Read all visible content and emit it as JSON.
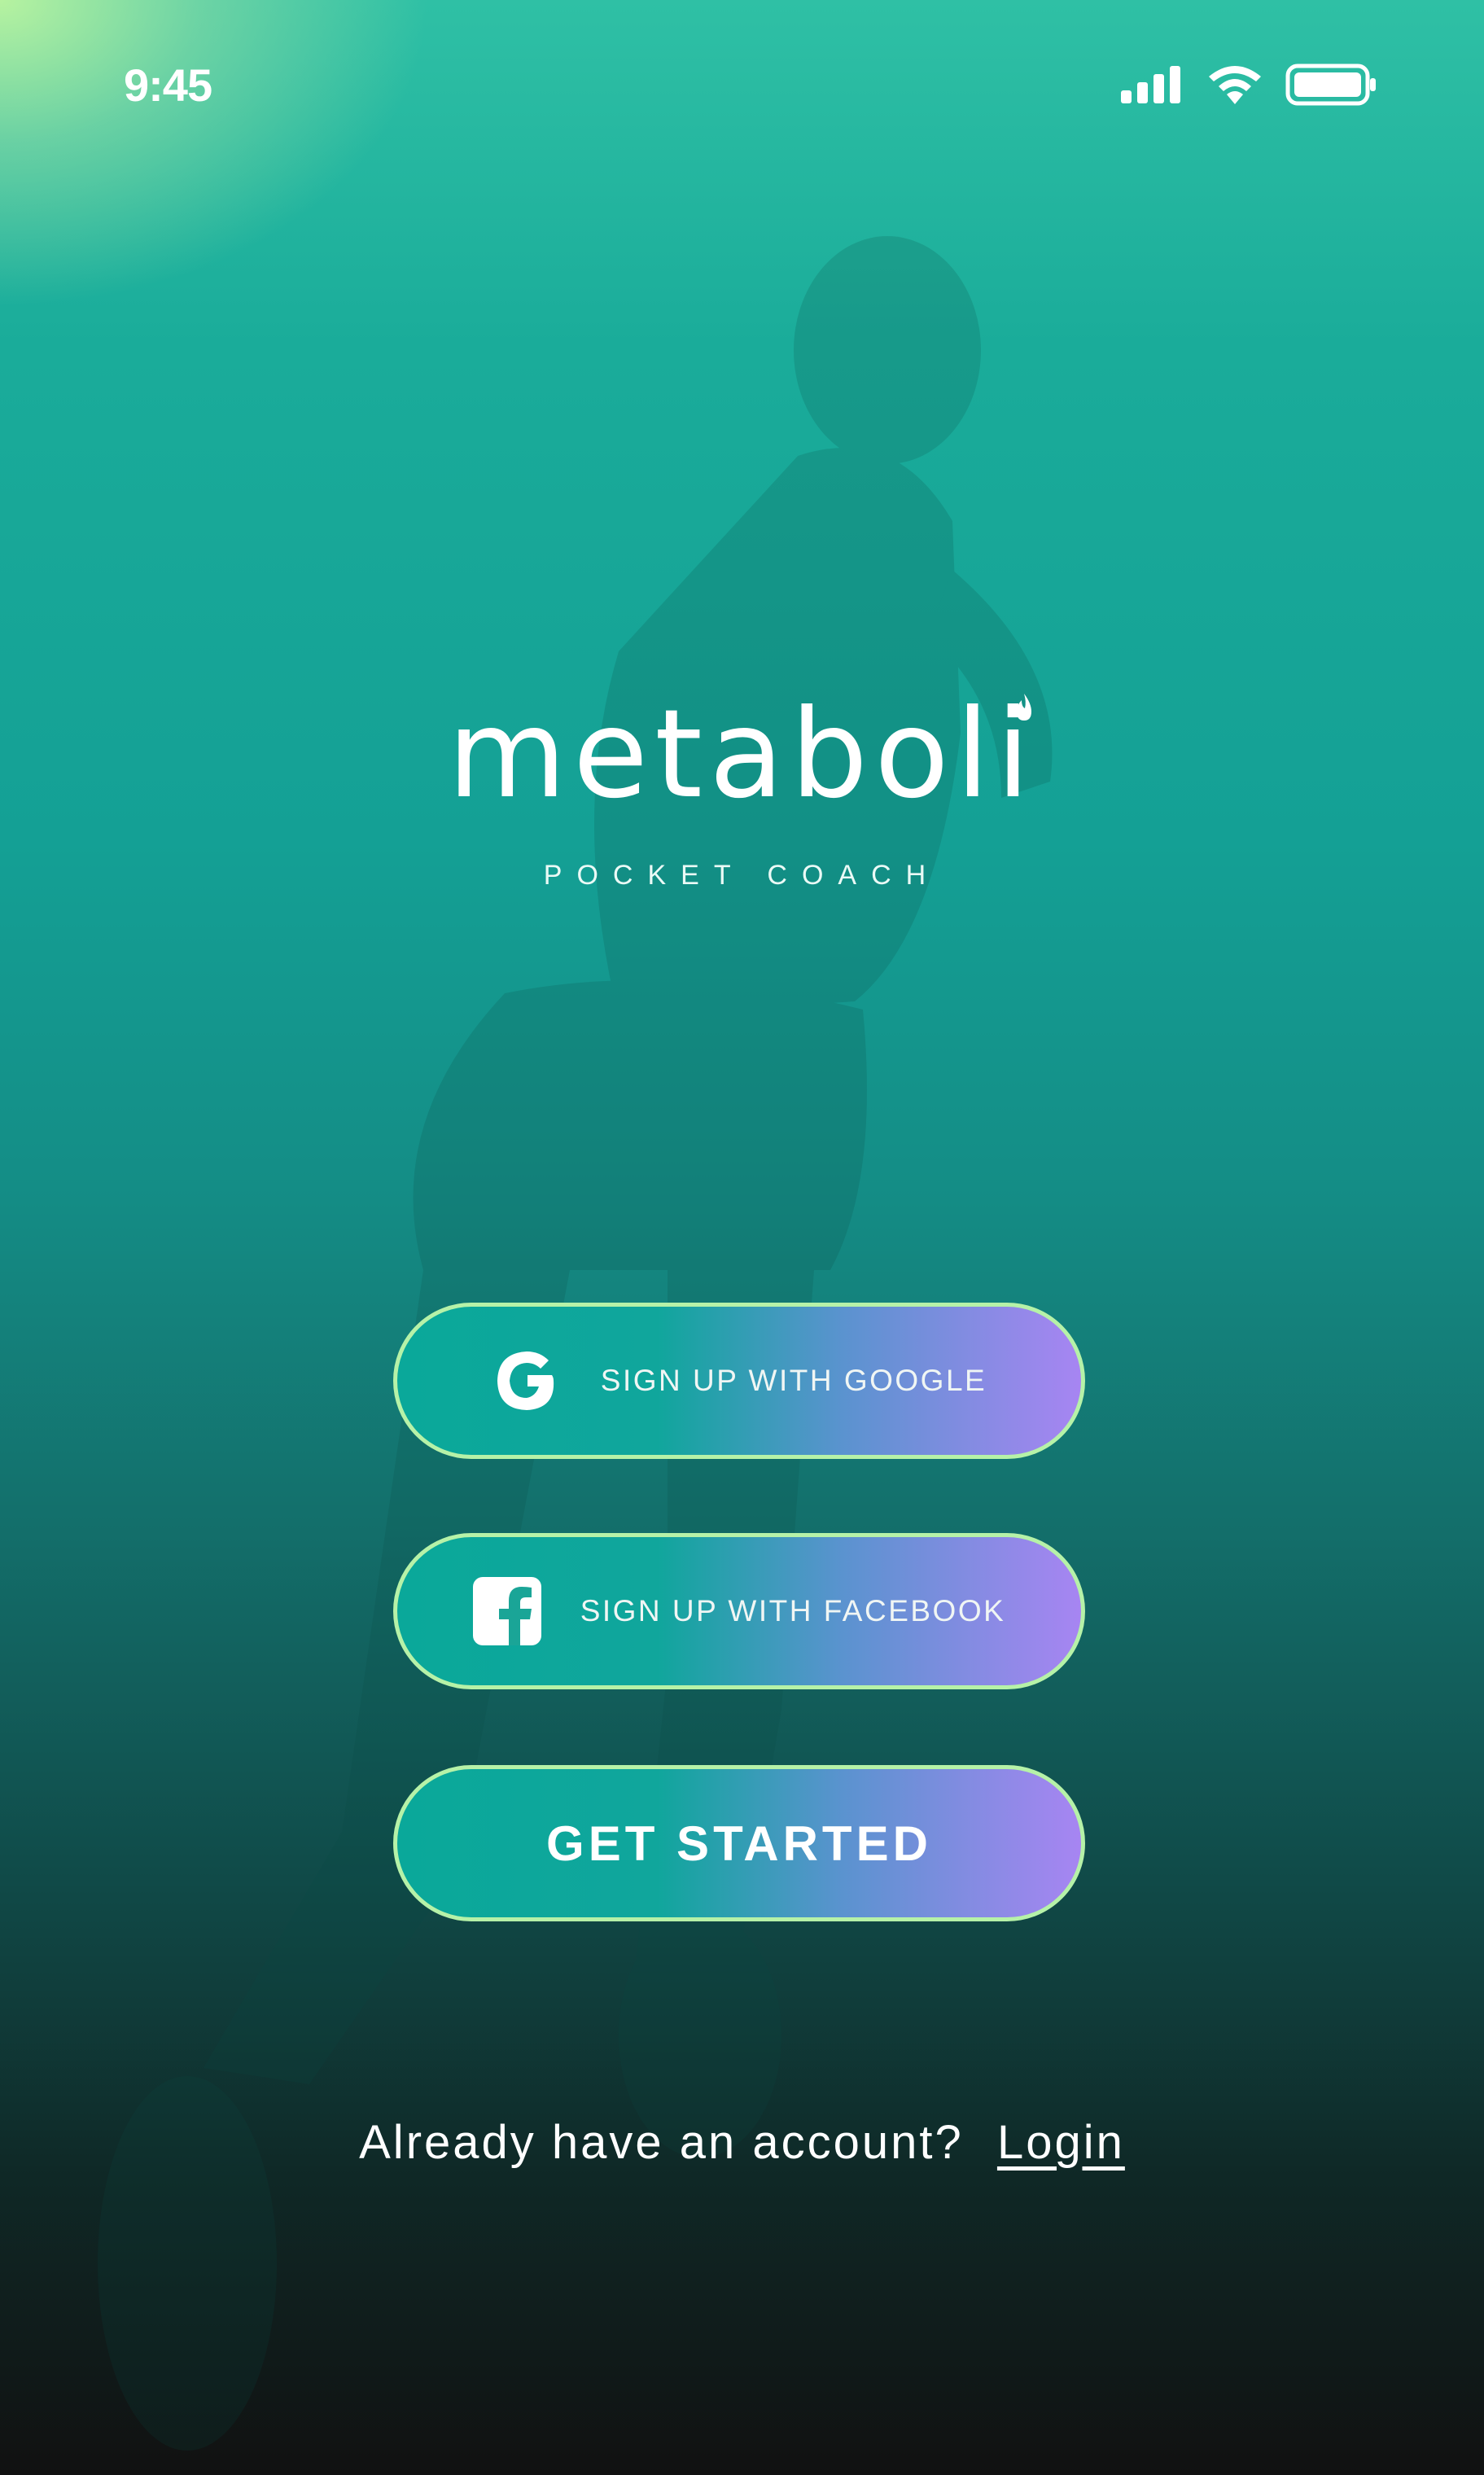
{
  "status_bar": {
    "time": "9:45",
    "icons": [
      "cellular-signal-icon",
      "wifi-icon",
      "battery-icon"
    ]
  },
  "brand": {
    "name": "metaboli",
    "tagline": "POCKET COACH"
  },
  "buttons": {
    "google": {
      "label": "SIGN UP WITH GOOGLE",
      "icon": "google-icon"
    },
    "facebook": {
      "label": "SIGN UP WITH FACEBOOK",
      "icon": "facebook-icon"
    },
    "start": {
      "label": "GET STARTED"
    }
  },
  "footer": {
    "prompt": "Already have an account?",
    "login_label": "Login"
  },
  "colors": {
    "gradient_top": "#2fc0a5",
    "gradient_bottom": "#111111",
    "button_start": "#0aa89a",
    "button_end": "#a785f2",
    "button_border": "#b6f2a8"
  }
}
